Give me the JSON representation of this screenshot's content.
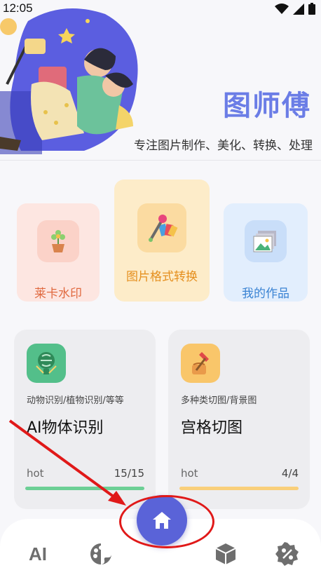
{
  "status": {
    "time": "12:05"
  },
  "brand": {
    "title": "图师傅",
    "subtitle": "专注图片制作、美化、转换、处理"
  },
  "features": [
    {
      "label": "莱卡水印"
    },
    {
      "label": "图片格式转换"
    },
    {
      "label": "我的作品"
    }
  ],
  "tools": [
    {
      "desc": "动物识别/植物识别/等等",
      "name": "AI物体识别",
      "hot": "hot",
      "count": "15/15",
      "progress": 1.0
    },
    {
      "desc": "多种类切图/背景图",
      "name": "宫格切图",
      "hot": "hot",
      "count": "4/4",
      "progress": 1.0
    }
  ],
  "nav": {
    "ai_label": "AI"
  },
  "colors": {
    "accent": "#5a63d8",
    "brand": "#6b7de6",
    "annotation": "#e01919"
  },
  "icons": [
    "wifi-icon",
    "signal-icon",
    "battery-icon",
    "flower-pot-icon",
    "color-swatch-icon",
    "gallery-icon",
    "brain-icon",
    "axe-icon",
    "home-icon",
    "palette-icon",
    "cube-icon",
    "percent-icon"
  ]
}
